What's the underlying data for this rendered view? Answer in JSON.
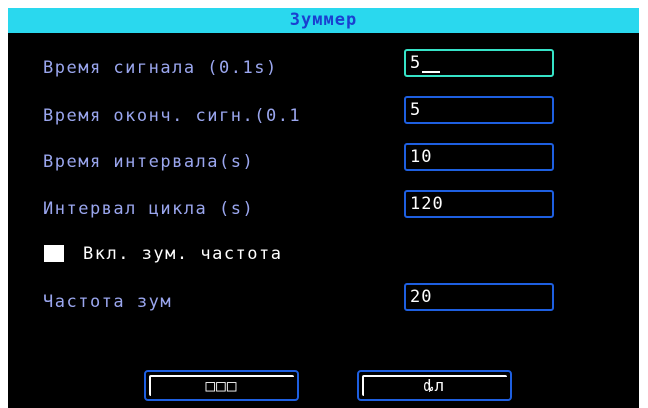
{
  "dialog": {
    "title": "Зуммер"
  },
  "fields": [
    {
      "label": "Время сигнала (0.1s)",
      "value": "5"
    },
    {
      "label": "Время оконч. сигн.(0.1",
      "value": "5"
    },
    {
      "label": "Время интервала(s)",
      "value": "10"
    },
    {
      "label": "Интервал цикла (s)",
      "value": "120"
    }
  ],
  "checkbox": {
    "label": "Вкл. зум. частота",
    "checked": false
  },
  "frequency": {
    "label": "Частота зум",
    "value": "20"
  },
  "buttons": {
    "ok_label": "□□□",
    "cancel_label": "ȡл"
  },
  "colors": {
    "title_bar": "#2ad8ee",
    "title_text": "#1a3fd0",
    "label_text": "#9aa6ee",
    "field_border": "#1e5fe0",
    "focused_border": "#36e3c7",
    "background": "#000000"
  }
}
